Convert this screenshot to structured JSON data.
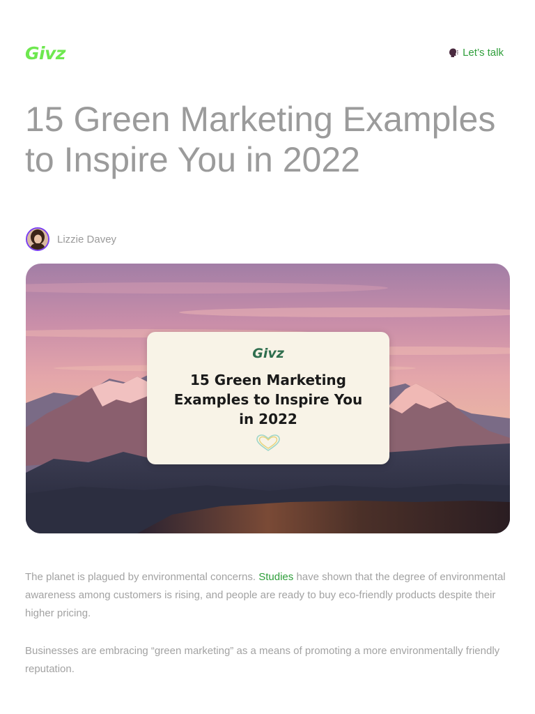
{
  "header": {
    "logo": "Givz",
    "cta_label": "Let’s talk",
    "cta_icon": "speaking-head-icon"
  },
  "article": {
    "title": "15 Green Marketing Examples to Inspire You in 2022",
    "author": "Lizzie Davey",
    "hero": {
      "card_logo": "Givz",
      "card_title": "15 Green Marketing Examples to Inspire You in 2022"
    },
    "paragraph1": {
      "before": "The planet is plagued by environmental concerns.",
      "link": "Studies",
      "after": "have shown that the degree of environmental awareness among customers is rising, and people are ready to buy eco-friendly products despite their higher pricing."
    },
    "paragraph2": "Businesses are embracing “green marketing” as a means of promoting a more environmentally friendly reputation."
  },
  "colors": {
    "brand_green": "#6ee84f",
    "link_green": "#2e9e3a",
    "avatar_ring": "#7a3ff0",
    "muted_text": "#9b9b9b"
  }
}
